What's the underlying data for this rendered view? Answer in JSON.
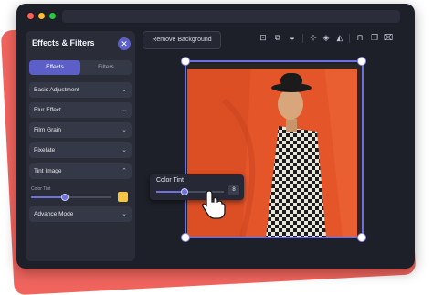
{
  "colors": {
    "accent": "#5b5fc7",
    "window_bg": "#1d1f29",
    "panel_bg": "#2a2d38",
    "backdrop": "#f0645e",
    "tint_swatch": "#f5c542"
  },
  "window": {
    "dots": [
      {
        "name": "close",
        "color": "#ff5f57"
      },
      {
        "name": "minimize",
        "color": "#febc2e"
      },
      {
        "name": "maximize",
        "color": "#28c840"
      }
    ]
  },
  "panel": {
    "title": "Effects & Filters",
    "close_icon": "close-icon",
    "tabs": [
      {
        "label": "Effects",
        "active": true
      },
      {
        "label": "Filters",
        "active": false
      }
    ],
    "accordion": [
      {
        "label": "Basic Adjustment",
        "expanded": false
      },
      {
        "label": "Blur Effect",
        "expanded": false
      },
      {
        "label": "Film Grain",
        "expanded": false
      },
      {
        "label": "Pixelate",
        "expanded": false
      },
      {
        "label": "Tint Image",
        "expanded": true
      },
      {
        "label": "Advance Mode",
        "expanded": false
      }
    ],
    "tint": {
      "label": "Color Tint",
      "value_fraction": 0.42,
      "color": "#f5c542"
    }
  },
  "toolbar": {
    "remove_bg_label": "Remove Background",
    "tools": [
      "crop-icon",
      "duplicate-icon",
      "mask-icon",
      "align-icon",
      "layers-icon",
      "flip-icon",
      "lock-icon",
      "copy-icon",
      "trash-icon"
    ]
  },
  "popup": {
    "label": "Color Tint",
    "value": "8",
    "value_fraction": 0.42
  }
}
